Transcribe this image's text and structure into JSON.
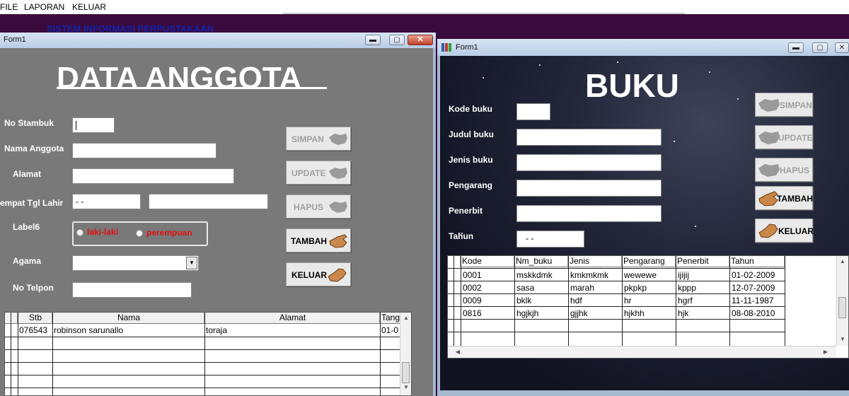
{
  "menu": [
    "FILE",
    "LAPORAN",
    "KELUAR"
  ],
  "app_title": "SISTEM INFORMASI PERPUSTAKAAN",
  "anggota": {
    "window_title": "Form1",
    "window_controls": {
      "minimize": "▬",
      "maximize": "▢",
      "close": "✕"
    },
    "heading": "DATA  ANGGOTA",
    "labels": {
      "no_stambuk": "No Stambuk",
      "nama_anggota": "Nama Anggota",
      "alamat": "Alamat",
      "tempat_tgl_lahir": "empat Tgl Lahir",
      "label6": "Label6",
      "agama": "Agama",
      "no_telpon": "No Telpon"
    },
    "values": {
      "tgl_lahir": "- -"
    },
    "radios": [
      "laki-laki",
      "perempuan"
    ],
    "buttons": {
      "simpan": "SIMPAN",
      "update": "UPDATE",
      "hapus": "HAPUS",
      "tambah": "TAMBAH",
      "keluar": "KELUAR"
    },
    "grid": {
      "headers": [
        "Stb",
        "Nama",
        "Alamat",
        "Tang"
      ],
      "rows": [
        [
          "076543",
          "robinson sarunallo",
          "toraja",
          "01-0"
        ]
      ]
    }
  },
  "buku": {
    "window_title": "Form1",
    "window_controls": {
      "minimize": "▬",
      "maximize": "▢",
      "close": "✕"
    },
    "heading": "BUKU",
    "labels": {
      "kode_buku": "Kode buku",
      "judul_buku": "Judul buku",
      "jenis_buku": "Jenis buku",
      "pengarang": "Pengarang",
      "penerbit": "Penerbit",
      "tahun": "Tahun"
    },
    "values": {
      "tahun": "- -"
    },
    "buttons": {
      "simpan": "SIMPAN",
      "update": "UPDATE",
      "hapus": "HAPUS",
      "tambah": "TAMBAH",
      "keluar": "KELUAR"
    },
    "grid": {
      "headers": [
        "Kode",
        "Nm_buku",
        "Jenis",
        "Pengarang",
        "Penerbit",
        "Tahun"
      ],
      "rows": [
        [
          "0001",
          "mskkdmk",
          "kmkmkmk",
          "wewewe",
          "ijijij",
          "01-02-2009"
        ],
        [
          "0002",
          "sasa",
          "marah",
          "pkpkp",
          "kppp",
          "12-07-2009"
        ],
        [
          "0009",
          "bklk",
          "hdf",
          "hr",
          "hgrf",
          "11-11-1987"
        ],
        [
          "0816",
          "hgjkjh",
          "gjjhk",
          "hjkhh",
          "hjk",
          "08-08-2010"
        ]
      ]
    }
  },
  "colors": {
    "window_bg": "#797979",
    "accent_red": "#e01010",
    "app_title_blue": "#1224a8",
    "desktop": "#3b0a3d"
  }
}
